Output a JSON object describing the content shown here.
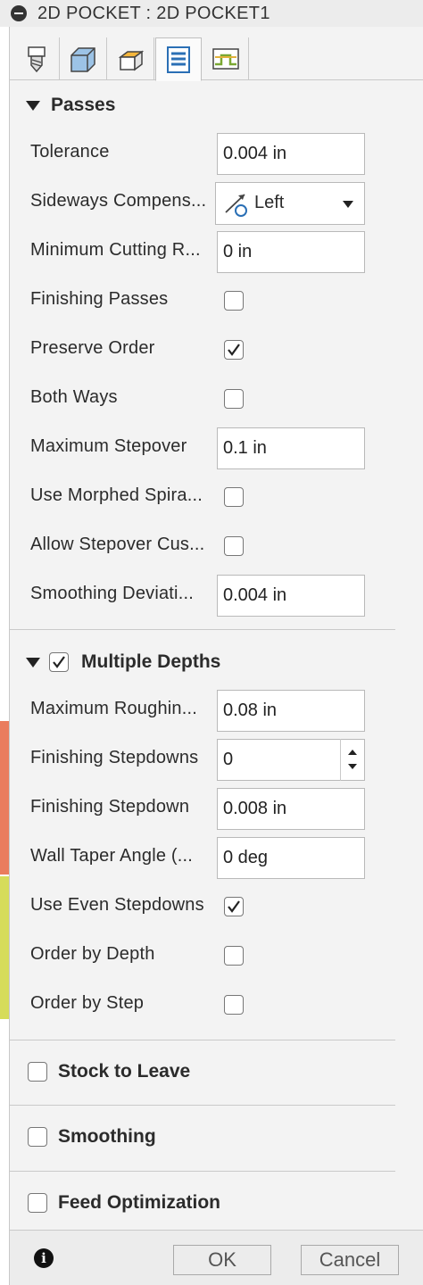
{
  "window": {
    "title": "2D POCKET : 2D POCKET1"
  },
  "tabs": [
    {
      "icon": "tool-icon",
      "active": false
    },
    {
      "icon": "geometry-icon",
      "active": false
    },
    {
      "icon": "heights-icon",
      "active": false
    },
    {
      "icon": "passes-icon",
      "active": true
    },
    {
      "icon": "linking-icon",
      "active": false
    }
  ],
  "passes": {
    "title": "Passes",
    "tolerance": {
      "label": "Tolerance",
      "value": "0.004 in"
    },
    "sideways": {
      "label": "Sideways Compens...",
      "value": "Left"
    },
    "min_cut_radius": {
      "label": "Minimum Cutting R...",
      "value": "0 in"
    },
    "finishing_passes": {
      "label": "Finishing Passes",
      "checked": false
    },
    "preserve_order": {
      "label": "Preserve Order",
      "checked": true
    },
    "both_ways": {
      "label": "Both Ways",
      "checked": false
    },
    "max_stepover": {
      "label": "Maximum Stepover",
      "value": "0.1 in"
    },
    "morphed_spiral": {
      "label": "Use Morphed Spira...",
      "checked": false
    },
    "allow_stepover": {
      "label": "Allow Stepover Cus...",
      "checked": false
    },
    "smoothing_dev": {
      "label": "Smoothing Deviati...",
      "value": "0.004 in"
    }
  },
  "multiple_depths": {
    "title": "Multiple Depths",
    "checked": true,
    "max_roughing": {
      "label": "Maximum Roughin...",
      "value": "0.08 in"
    },
    "finishing_stepdowns": {
      "label": "Finishing Stepdowns",
      "value": "0"
    },
    "finishing_stepdown": {
      "label": "Finishing Stepdown",
      "value": "0.008 in"
    },
    "wall_taper": {
      "label": "Wall Taper Angle (...",
      "value": "0 deg"
    },
    "even_stepdowns": {
      "label": "Use Even Stepdowns",
      "checked": true
    },
    "order_by_depth": {
      "label": "Order by Depth",
      "checked": false
    },
    "order_by_step": {
      "label": "Order by Step",
      "checked": false
    }
  },
  "stock_to_leave": {
    "title": "Stock to Leave",
    "checked": false
  },
  "smoothing": {
    "title": "Smoothing",
    "checked": false
  },
  "feed_optimization": {
    "title": "Feed Optimization",
    "checked": false
  },
  "footer": {
    "ok_label": "OK",
    "cancel_label": "Cancel"
  },
  "colors": {
    "panel_bg": "#f3f3f3",
    "field_bg": "#ffffff",
    "accent_icon": "#2a6fb5",
    "viewport_orange": "#ea7c5e",
    "viewport_yellow": "#d6dc5a"
  }
}
